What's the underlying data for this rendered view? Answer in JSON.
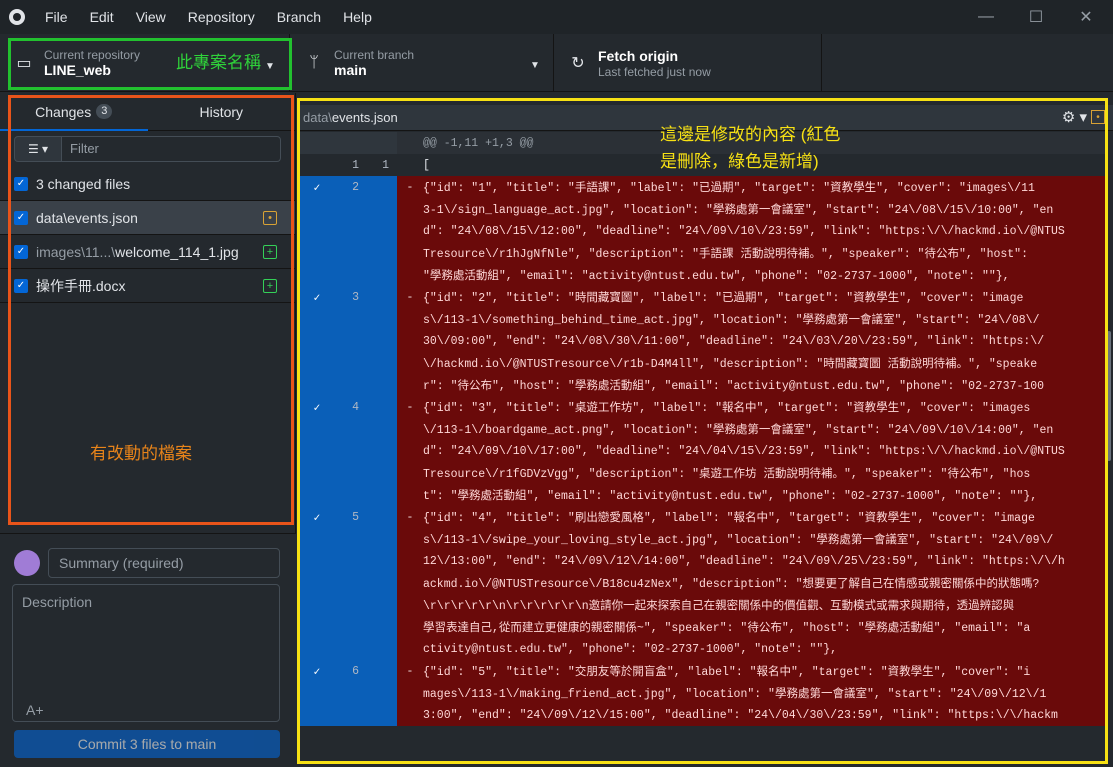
{
  "menu": [
    "File",
    "Edit",
    "View",
    "Repository",
    "Branch",
    "Help"
  ],
  "window_controls": {
    "minimize": "—",
    "maximize": "☐",
    "close": "✕"
  },
  "toolbar": {
    "repo_label": "Current repository",
    "repo_name": "LINE_web",
    "branch_label": "Current branch",
    "branch_name": "main",
    "fetch_title": "Fetch origin",
    "fetch_sub": "Last fetched just now"
  },
  "annotations": {
    "repo_note": "此專案名稱",
    "files_note": "有改動的檔案",
    "diff_note_1": "這邊是修改的內容 (紅色",
    "diff_note_2": "是刪除，綠色是新增)"
  },
  "sidebar": {
    "tab_changes": "Changes",
    "changes_count": "3",
    "tab_history": "History",
    "filter_placeholder": "Filter",
    "changed_files_label": "3 changed files",
    "files": [
      {
        "dim": "",
        "name": "data\\events.json",
        "status": "•"
      },
      {
        "dim": "images\\11...\\",
        "name": "welcome_114_1.jpg",
        "status": "+"
      },
      {
        "dim": "",
        "name": "操作手冊.docx",
        "status": "+"
      }
    ],
    "summary_placeholder": "Summary (required)",
    "description_placeholder": "Description",
    "coauthor_icon": "A+",
    "commit_button": "Commit 3 files to main"
  },
  "diff": {
    "path_dir": "data\\",
    "path_file": "events.json",
    "lines": [
      {
        "type": "hunk",
        "check": "",
        "old": "",
        "new": "",
        "sign": "",
        "text": "@@ -1,11 +1,3 @@"
      },
      {
        "type": "ctx",
        "check": "",
        "old": "1",
        "new": "1",
        "sign": "",
        "text": "["
      },
      {
        "type": "del",
        "check": "✓",
        "old": "2",
        "new": "",
        "sign": "-",
        "text": "  {\"id\": \"1\", \"title\": \"手語課\", \"label\": \"已過期\", \"target\": \"資教學生\", \"cover\": \"images\\/11"
      },
      {
        "type": "del",
        "check": "",
        "old": "",
        "new": "",
        "sign": "",
        "text": "3-1\\/sign_language_act.jpg\", \"location\": \"學務處第一會議室\", \"start\": \"24\\/08\\/15\\/10:00\", \"en"
      },
      {
        "type": "del",
        "check": "",
        "old": "",
        "new": "",
        "sign": "",
        "text": "d\": \"24\\/08\\/15\\/12:00\", \"deadline\": \"24\\/09\\/10\\/23:59\", \"link\": \"https:\\/\\/hackmd.io\\/@NTUS"
      },
      {
        "type": "del",
        "check": "",
        "old": "",
        "new": "",
        "sign": "",
        "text": "Tresource\\/r1hJgNfNle\", \"description\": \"手語課 活動說明待補。\", \"speaker\": \"待公布\", \"host\":"
      },
      {
        "type": "del",
        "check": "",
        "old": "",
        "new": "",
        "sign": "",
        "text": "\"學務處活動組\", \"email\": \"activity@ntust.edu.tw\", \"phone\": \"02-2737-1000\", \"note\": \"\"},"
      },
      {
        "type": "del",
        "check": "✓",
        "old": "3",
        "new": "",
        "sign": "-",
        "text": "  {\"id\": \"2\", \"title\": \"時間藏寶圖\", \"label\": \"已過期\", \"target\": \"資教學生\", \"cover\": \"image"
      },
      {
        "type": "del",
        "check": "",
        "old": "",
        "new": "",
        "sign": "",
        "text": "s\\/113-1\\/something_behind_time_act.jpg\", \"location\": \"學務處第一會議室\", \"start\": \"24\\/08\\/"
      },
      {
        "type": "del",
        "check": "",
        "old": "",
        "new": "",
        "sign": "",
        "text": "30\\/09:00\", \"end\": \"24\\/08\\/30\\/11:00\", \"deadline\": \"24\\/03\\/20\\/23:59\", \"link\": \"https:\\/"
      },
      {
        "type": "del",
        "check": "",
        "old": "",
        "new": "",
        "sign": "",
        "text": "\\/hackmd.io\\/@NTUSTresource\\/r1b-D4M4ll\", \"description\": \"時間藏寶圖 活動說明待補。\", \"speake"
      },
      {
        "type": "del",
        "check": "",
        "old": "",
        "new": "",
        "sign": "",
        "text": "r\": \"待公布\", \"host\": \"學務處活動組\", \"email\": \"activity@ntust.edu.tw\", \"phone\": \"02-2737-100"
      },
      {
        "type": "del",
        "check": "✓",
        "old": "4",
        "new": "",
        "sign": "-",
        "text": "  {\"id\": \"3\", \"title\": \"桌遊工作坊\", \"label\": \"報名中\", \"target\": \"資教學生\", \"cover\": \"images"
      },
      {
        "type": "del",
        "check": "",
        "old": "",
        "new": "",
        "sign": "",
        "text": "\\/113-1\\/boardgame_act.png\", \"location\": \"學務處第一會議室\", \"start\": \"24\\/09\\/10\\/14:00\", \"en"
      },
      {
        "type": "del",
        "check": "",
        "old": "",
        "new": "",
        "sign": "",
        "text": "d\": \"24\\/09\\/10\\/17:00\", \"deadline\": \"24\\/04\\/15\\/23:59\", \"link\": \"https:\\/\\/hackmd.io\\/@NTUS"
      },
      {
        "type": "del",
        "check": "",
        "old": "",
        "new": "",
        "sign": "",
        "text": "Tresource\\/r1fGDVzVgg\", \"description\": \"桌遊工作坊 活動說明待補。\", \"speaker\": \"待公布\", \"hos"
      },
      {
        "type": "del",
        "check": "",
        "old": "",
        "new": "",
        "sign": "",
        "text": "t\": \"學務處活動組\", \"email\": \"activity@ntust.edu.tw\", \"phone\": \"02-2737-1000\", \"note\": \"\"},"
      },
      {
        "type": "del",
        "check": "✓",
        "old": "5",
        "new": "",
        "sign": "-",
        "text": "  {\"id\": \"4\", \"title\": \"刷出戀愛風格\", \"label\": \"報名中\", \"target\": \"資教學生\", \"cover\": \"image"
      },
      {
        "type": "del",
        "check": "",
        "old": "",
        "new": "",
        "sign": "",
        "text": "s\\/113-1\\/swipe_your_loving_style_act.jpg\", \"location\": \"學務處第一會議室\", \"start\": \"24\\/09\\/"
      },
      {
        "type": "del",
        "check": "",
        "old": "",
        "new": "",
        "sign": "",
        "text": "12\\/13:00\", \"end\": \"24\\/09\\/12\\/14:00\", \"deadline\": \"24\\/09\\/25\\/23:59\", \"link\": \"https:\\/\\/h"
      },
      {
        "type": "del",
        "check": "",
        "old": "",
        "new": "",
        "sign": "",
        "text": "ackmd.io\\/@NTUSTresource\\/B18cu4zNex\", \"description\": \"想要更了解自己在情感或親密關係中的狀態嗎?"
      },
      {
        "type": "del",
        "check": "",
        "old": "",
        "new": "",
        "sign": "",
        "text": "\\r\\r\\r\\r\\r\\n\\r\\r\\r\\r\\r\\n邀請你一起來探索自己在親密關係中的價值觀、互動模式或需求與期待，透過辨認與"
      },
      {
        "type": "del",
        "check": "",
        "old": "",
        "new": "",
        "sign": "",
        "text": "學習表達自己,從而建立更健康的親密關係~\", \"speaker\": \"待公布\", \"host\": \"學務處活動組\", \"email\": \"a"
      },
      {
        "type": "del",
        "check": "",
        "old": "",
        "new": "",
        "sign": "",
        "text": "ctivity@ntust.edu.tw\", \"phone\": \"02-2737-1000\", \"note\": \"\"},"
      },
      {
        "type": "del",
        "check": "✓",
        "old": "6",
        "new": "",
        "sign": "-",
        "text": "  {\"id\": \"5\", \"title\": \"交朋友等於開盲盒\", \"label\": \"報名中\", \"target\": \"資教學生\", \"cover\": \"i"
      },
      {
        "type": "del",
        "check": "",
        "old": "",
        "new": "",
        "sign": "",
        "text": "mages\\/113-1\\/making_friend_act.jpg\", \"location\": \"學務處第一會議室\", \"start\": \"24\\/09\\/12\\/1"
      },
      {
        "type": "del",
        "check": "",
        "old": "",
        "new": "",
        "sign": "",
        "text": "3:00\", \"end\": \"24\\/09\\/12\\/15:00\", \"deadline\": \"24\\/04\\/30\\/23:59\", \"link\": \"https:\\/\\/hackm"
      }
    ]
  },
  "colors": {
    "repo_note": "#2fd13a",
    "files_note": "#e8841a",
    "diff_note": "#f7e114"
  }
}
